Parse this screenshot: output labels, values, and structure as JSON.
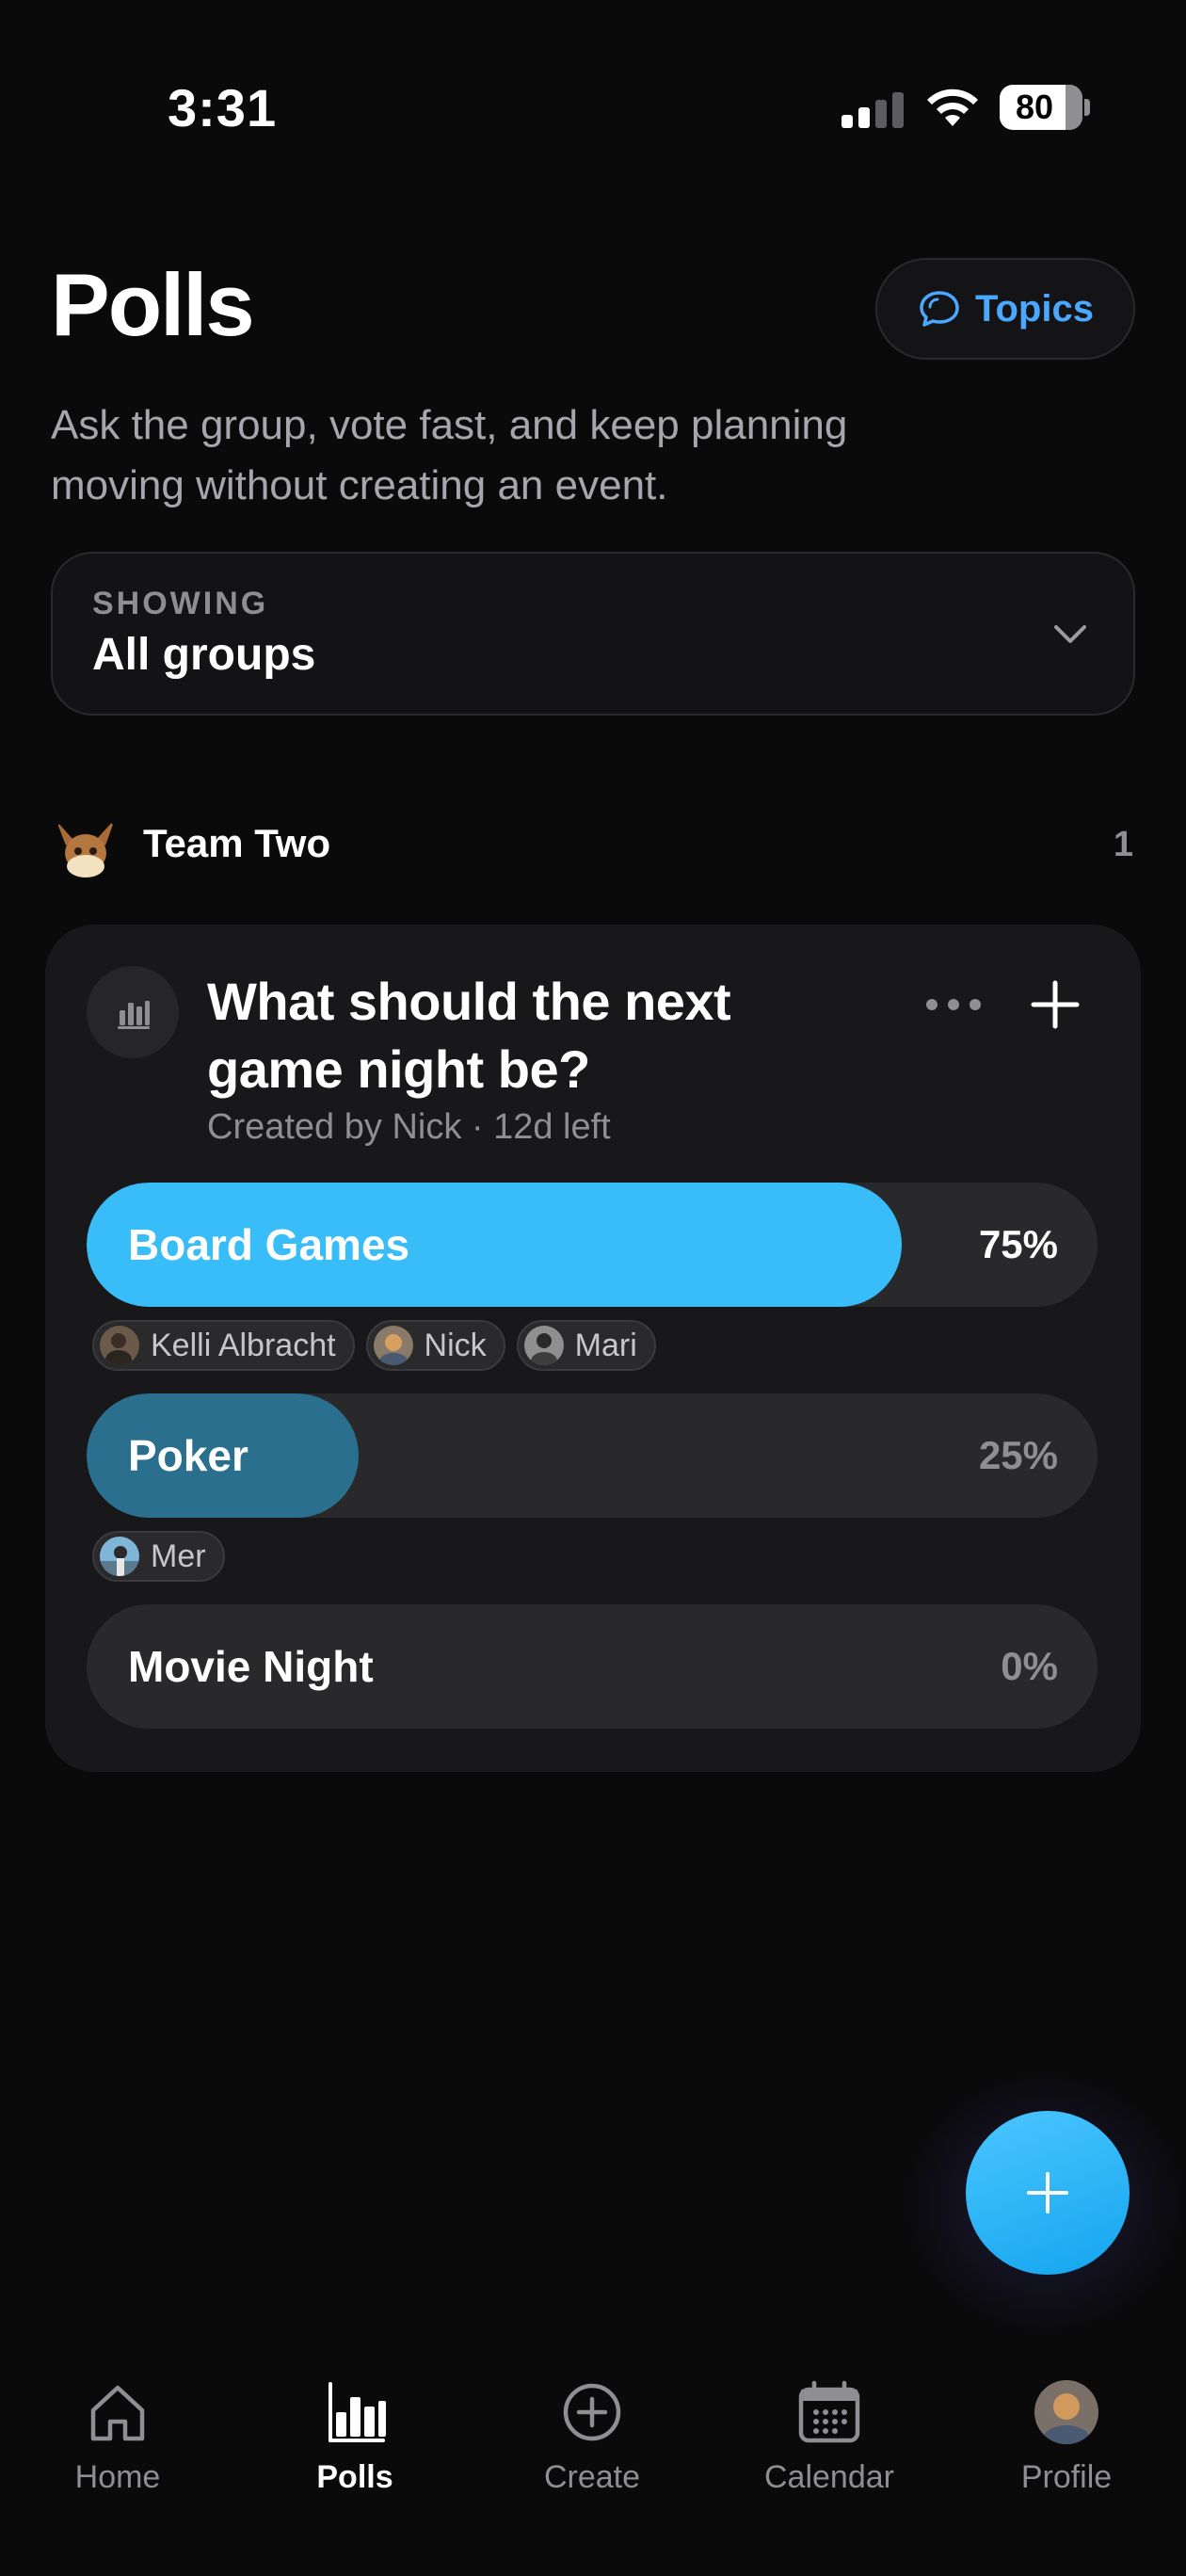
{
  "status_bar": {
    "time": "3:31",
    "battery": "80"
  },
  "header": {
    "title": "Polls",
    "topics_label": "Topics",
    "subtitle": "Ask the group, vote fast, and keep planning moving without creating an event."
  },
  "filter": {
    "label": "SHOWING",
    "value": "All groups"
  },
  "group": {
    "name": "Team Two",
    "count": "1"
  },
  "poll": {
    "question": "What should the next game night be?",
    "meta": "Created by Nick · 12d left",
    "options": [
      {
        "label": "Board Games",
        "percent": "75%",
        "fraction": 0.75,
        "voters": [
          "Kelli Albracht",
          "Nick",
          "Mari"
        ]
      },
      {
        "label": "Poker",
        "percent": "25%",
        "fraction": 0.25,
        "voters": [
          "Mer"
        ]
      },
      {
        "label": "Movie Night",
        "percent": "0%",
        "fraction": 0,
        "voters": []
      }
    ]
  },
  "tabs": [
    {
      "label": "Home",
      "icon": "home-icon"
    },
    {
      "label": "Polls",
      "icon": "polls-icon",
      "active": true
    },
    {
      "label": "Create",
      "icon": "create-icon"
    },
    {
      "label": "Calendar",
      "icon": "calendar-icon"
    },
    {
      "label": "Profile",
      "icon": "profile-avatar"
    }
  ],
  "colors": {
    "accent": "#38bdf8",
    "link": "#4aa8ff",
    "leading_fill": "#38bdf8",
    "secondary_fill": "#2b6f8e",
    "background": "#0a0a0b",
    "card": "#18181a"
  }
}
